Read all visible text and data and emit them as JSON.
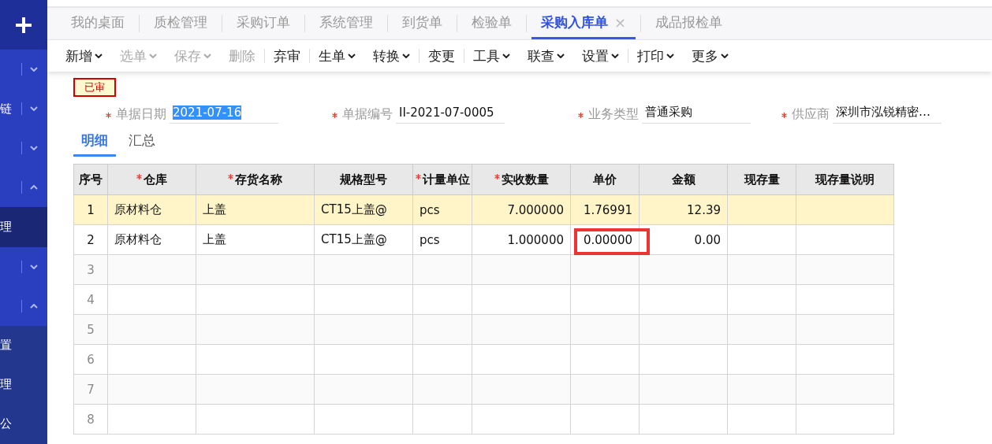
{
  "sidebar": {
    "items": [
      {
        "kind": "toggle",
        "expanded": false
      },
      {
        "kind": "toggle",
        "label": "链",
        "expanded": false
      },
      {
        "kind": "toggle",
        "expanded": false
      },
      {
        "kind": "toggle",
        "expanded": true
      },
      {
        "kind": "link",
        "label": "理",
        "selected": true
      },
      {
        "kind": "toggle",
        "expanded": false
      },
      {
        "kind": "toggle",
        "expanded": true
      },
      {
        "kind": "link",
        "label": "置",
        "selected": false
      },
      {
        "kind": "link",
        "label": "理",
        "selected": false
      },
      {
        "kind": "link",
        "label": "公",
        "selected": false
      }
    ]
  },
  "tabs": [
    {
      "label": "我的桌面",
      "selected": false
    },
    {
      "label": "质检管理",
      "selected": false
    },
    {
      "label": "采购订单",
      "selected": false
    },
    {
      "label": "系统管理",
      "selected": false
    },
    {
      "label": "到货单",
      "selected": false
    },
    {
      "label": "检验单",
      "selected": false
    },
    {
      "label": "采购入库单",
      "selected": true,
      "close_glyph": "×"
    },
    {
      "label": "成品报检单",
      "selected": false
    }
  ],
  "toolbar": [
    {
      "label": "新增",
      "dropdown": true,
      "disabled": false,
      "separator": false
    },
    {
      "label": "选单",
      "dropdown": true,
      "disabled": true,
      "separator": false
    },
    {
      "label": "保存",
      "dropdown": true,
      "disabled": true,
      "separator": false
    },
    {
      "label": "删除",
      "dropdown": false,
      "disabled": true,
      "separator": true
    },
    {
      "label": "弃审",
      "dropdown": false,
      "disabled": false,
      "separator": true
    },
    {
      "label": "生单",
      "dropdown": true,
      "disabled": false,
      "separator": false
    },
    {
      "label": "转换",
      "dropdown": true,
      "disabled": false,
      "separator": true
    },
    {
      "label": "变更",
      "dropdown": false,
      "disabled": false,
      "separator": true
    },
    {
      "label": "工具",
      "dropdown": true,
      "disabled": false,
      "separator": false
    },
    {
      "label": "联查",
      "dropdown": true,
      "disabled": false,
      "separator": false
    },
    {
      "label": "设置",
      "dropdown": true,
      "disabled": false,
      "separator": true
    },
    {
      "label": "打印",
      "dropdown": true,
      "disabled": false,
      "separator": false
    },
    {
      "label": "更多",
      "dropdown": true,
      "disabled": false,
      "separator": false
    }
  ],
  "status_stamp": "已审",
  "fields": [
    {
      "label": "单据日期",
      "required": true,
      "value": "2021-07-16",
      "text_selected": true
    },
    {
      "label": "单据编号",
      "required": true,
      "value": "II-2021-07-0005",
      "text_selected": false
    },
    {
      "label": "业务类型",
      "required": true,
      "value": "普通采购",
      "text_selected": false
    },
    {
      "label": "供应商",
      "required": true,
      "value": "深圳市泓锐精密…",
      "text_selected": false
    }
  ],
  "detail_tabs": [
    {
      "label": "明细",
      "selected": true
    },
    {
      "label": "汇总",
      "selected": false
    }
  ],
  "table": {
    "columns": [
      {
        "label": "序号",
        "required": false
      },
      {
        "label": "仓库",
        "required": true
      },
      {
        "label": "存货名称",
        "required": true
      },
      {
        "label": "规格型号",
        "required": false
      },
      {
        "label": "计量单位",
        "required": true
      },
      {
        "label": "实收数量",
        "required": true
      },
      {
        "label": "单价",
        "required": false
      },
      {
        "label": "金额",
        "required": false
      },
      {
        "label": "现存量",
        "required": false
      },
      {
        "label": "现存量说明",
        "required": false
      }
    ],
    "rows": [
      {
        "cells": [
          "1",
          "原材料仓",
          "上盖",
          "CT15上盖@",
          "pcs",
          "7.000000",
          "1.76991",
          "12.39",
          "",
          ""
        ],
        "selected": true,
        "price_marked": false
      },
      {
        "cells": [
          "2",
          "原材料仓",
          "上盖",
          "CT15上盖@",
          "pcs",
          "1.000000",
          "0.00000",
          "0.00",
          "",
          ""
        ],
        "selected": false,
        "price_marked": true
      },
      {
        "cells": [
          "3",
          "",
          "",
          "",
          "",
          "",
          "",
          "",
          "",
          ""
        ],
        "selected": false,
        "price_marked": false
      },
      {
        "cells": [
          "4",
          "",
          "",
          "",
          "",
          "",
          "",
          "",
          "",
          ""
        ],
        "selected": false,
        "price_marked": false
      },
      {
        "cells": [
          "5",
          "",
          "",
          "",
          "",
          "",
          "",
          "",
          "",
          ""
        ],
        "selected": false,
        "price_marked": false
      },
      {
        "cells": [
          "6",
          "",
          "",
          "",
          "",
          "",
          "",
          "",
          "",
          ""
        ],
        "selected": false,
        "price_marked": false
      },
      {
        "cells": [
          "7",
          "",
          "",
          "",
          "",
          "",
          "",
          "",
          "",
          ""
        ],
        "selected": false,
        "price_marked": false
      },
      {
        "cells": [
          "8",
          "",
          "",
          "",
          "",
          "",
          "",
          "",
          "",
          ""
        ],
        "selected": false,
        "price_marked": false
      }
    ]
  }
}
